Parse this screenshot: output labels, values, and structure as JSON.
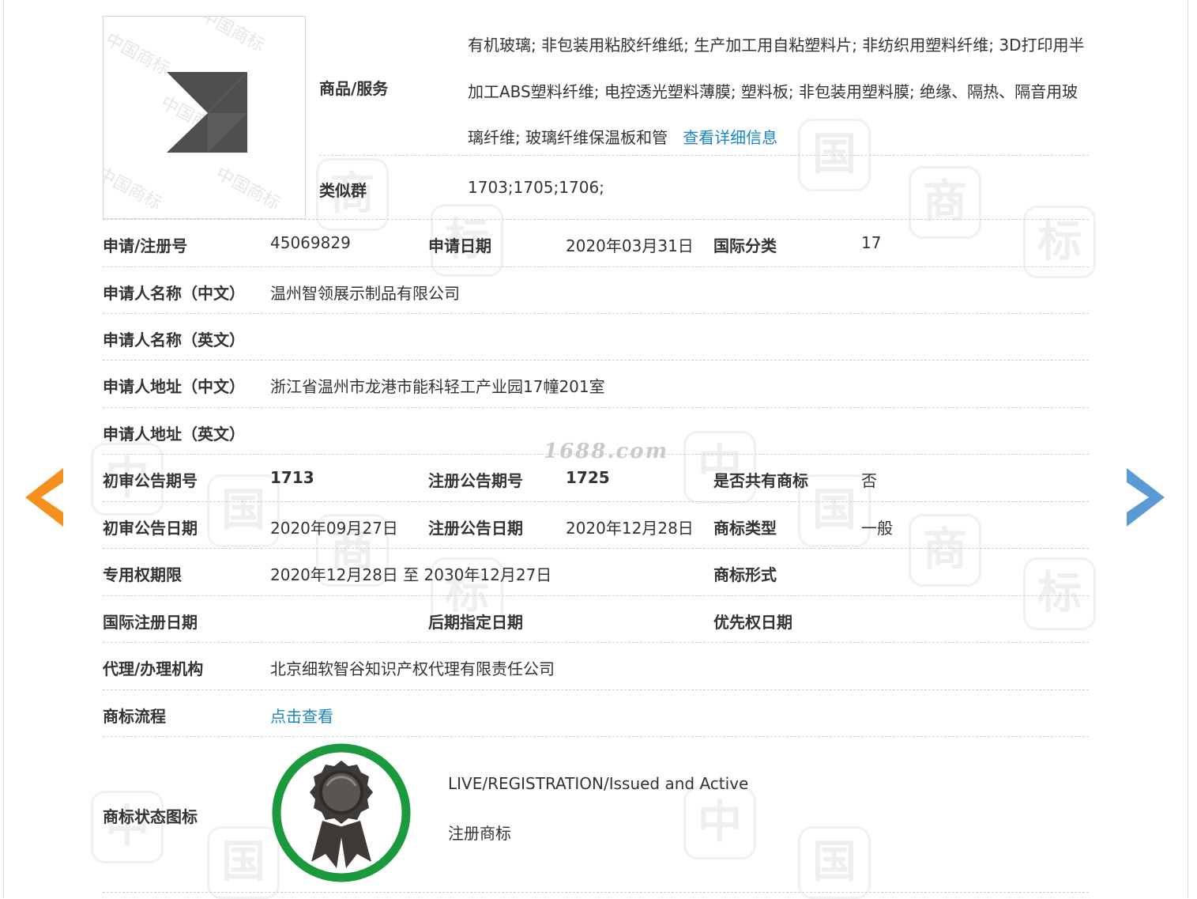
{
  "navigation": {
    "prev_icon": "chevron-left-icon",
    "next_icon": "chevron-right-icon",
    "prev_color": "#f5901e",
    "next_color": "#5b9bd5"
  },
  "watermarks": {
    "site": "1688.com",
    "tile_chars": [
      "中",
      "国",
      "商",
      "标"
    ],
    "logo_text": "中国商标"
  },
  "trademark": {
    "image_icon": "trademark-logo-z-icon",
    "goods_label": "商品/服务",
    "goods_value": "有机玻璃; 非包装用粘胶纤维纸; 生产加工用自粘塑料片; 非纺织用塑料纤维; 3D打印用半加工ABS塑料纤维; 电控透光塑料薄膜; 塑料板; 非包装用塑料膜; 绝缘、隔热、隔音用玻璃纤维; 玻璃纤维保温板和管",
    "goods_more_link": "查看详细信息",
    "similar_group_label": "类似群",
    "similar_group_value": "1703;1705;1706;"
  },
  "fields": {
    "reg_no_label": "申请/注册号",
    "reg_no_value": "45069829",
    "apply_date_label": "申请日期",
    "apply_date_value": "2020年03月31日",
    "intl_class_label": "国际分类",
    "intl_class_value": "17",
    "applicant_cn_label": "申请人名称（中文）",
    "applicant_cn_value": "温州智领展示制品有限公司",
    "applicant_en_label": "申请人名称（英文）",
    "applicant_en_value": "",
    "address_cn_label": "申请人地址（中文）",
    "address_cn_value": "浙江省温州市龙港市能科轻工产业园17幢201室",
    "address_en_label": "申请人地址（英文）",
    "address_en_value": "",
    "prelim_issue_label": "初审公告期号",
    "prelim_issue_value": "1713",
    "reg_issue_label": "注册公告期号",
    "reg_issue_value": "1725",
    "shared_label": "是否共有商标",
    "shared_value": "否",
    "prelim_date_label": "初审公告日期",
    "prelim_date_value": "2020年09月27日",
    "reg_date_label": "注册公告日期",
    "reg_date_value": "2020年12月28日",
    "tm_type_label": "商标类型",
    "tm_type_value": "一般",
    "exclusive_label": "专用权期限",
    "exclusive_value": "2020年12月28日 至 2030年12月27日",
    "tm_form_label": "商标形式",
    "tm_form_value": "",
    "intl_reg_date_label": "国际注册日期",
    "intl_reg_date_value": "",
    "later_designation_label": "后期指定日期",
    "later_designation_value": "",
    "priority_date_label": "优先权日期",
    "priority_date_value": "",
    "agency_label": "代理/办理机构",
    "agency_value": "北京细软智谷知识产权代理有限责任公司",
    "process_label": "商标流程",
    "process_link": "点击查看"
  },
  "status": {
    "label": "商标状态图标",
    "icon": "award-ribbon-icon",
    "ring_color": "#1a9a3c",
    "english": "LIVE/REGISTRATION/Issued and Active",
    "chinese": "注册商标"
  }
}
